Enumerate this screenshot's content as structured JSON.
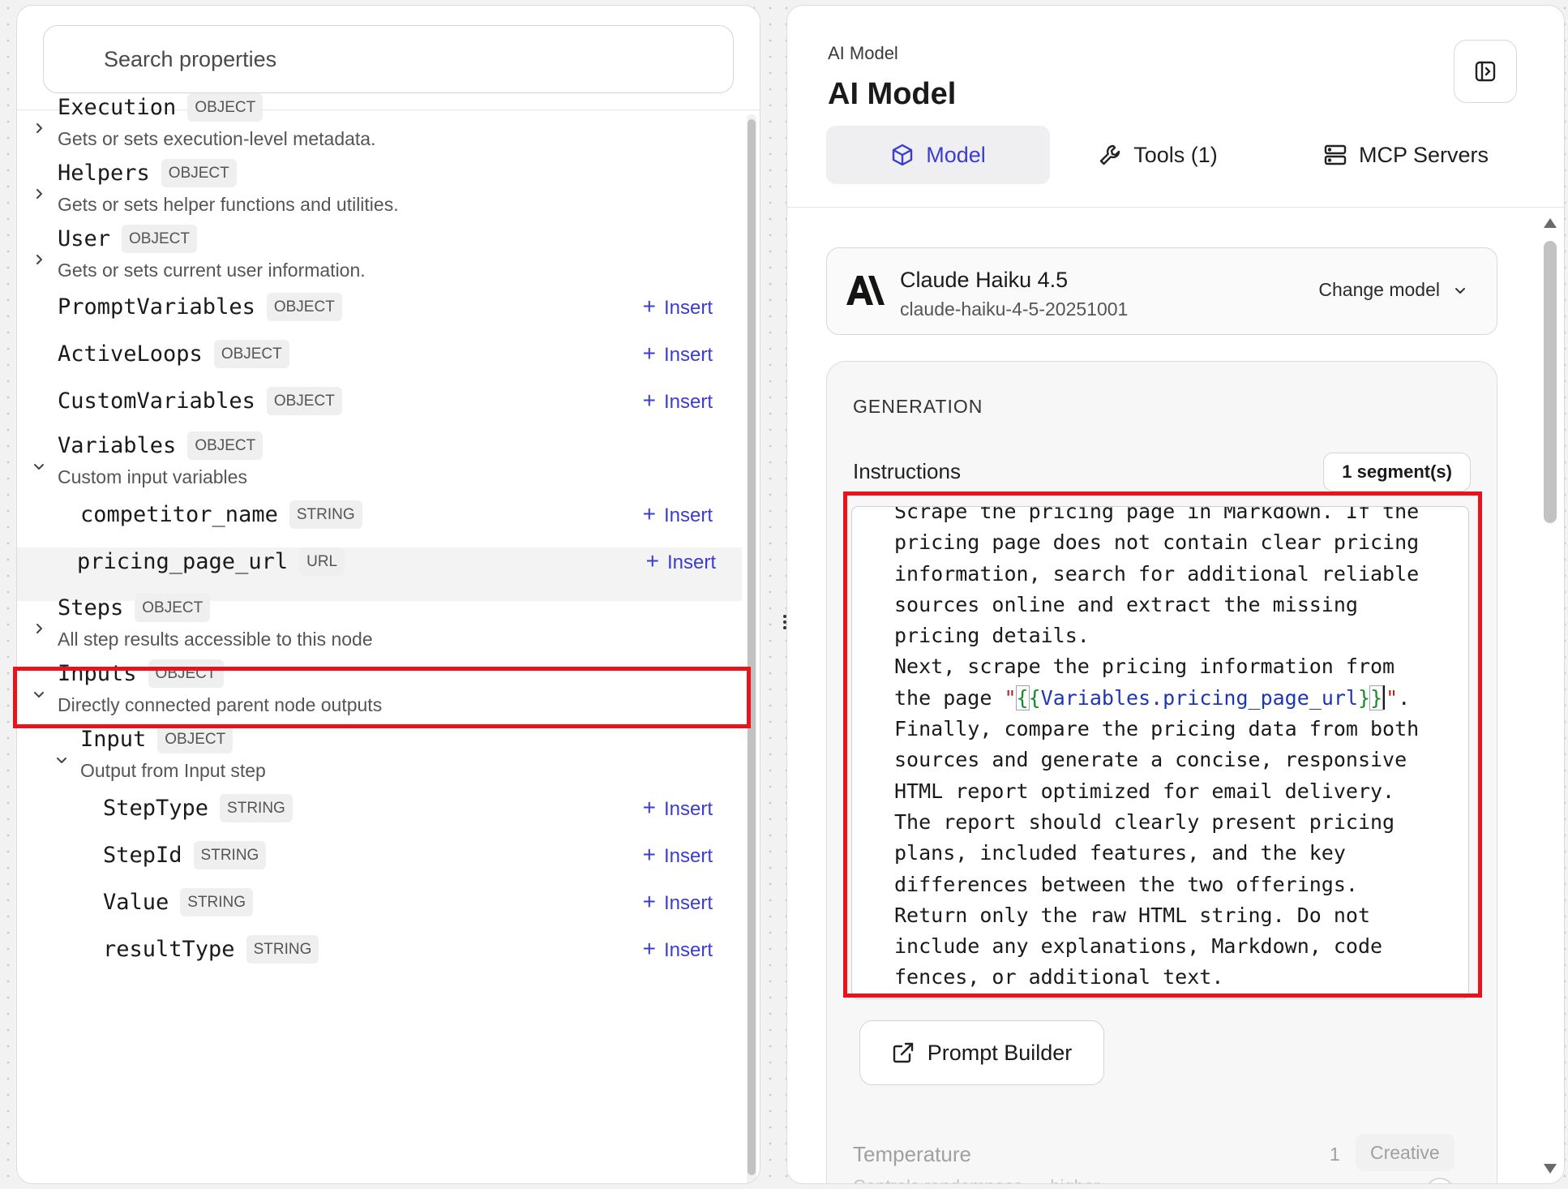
{
  "left_panel": {
    "search": {
      "placeholder": "Search properties",
      "value": ""
    },
    "properties": [
      {
        "name": "Execution",
        "type": "OBJECT",
        "desc": "Gets or sets execution-level metadata.",
        "expander": "collapsed"
      },
      {
        "name": "Helpers",
        "type": "OBJECT",
        "desc": "Gets or sets helper functions and utilities.",
        "expander": "collapsed"
      },
      {
        "name": "User",
        "type": "OBJECT",
        "desc": "Gets or sets current user information.",
        "expander": "collapsed"
      },
      {
        "name": "PromptVariables",
        "type": "OBJECT",
        "action": "Insert"
      },
      {
        "name": "ActiveLoops",
        "type": "OBJECT",
        "action": "Insert"
      },
      {
        "name": "CustomVariables",
        "type": "OBJECT",
        "action": "Insert"
      },
      {
        "name": "Variables",
        "type": "OBJECT",
        "desc": "Custom input variables",
        "expander": "expanded"
      },
      {
        "name": "competitor_name",
        "type": "STRING",
        "action": "Insert"
      },
      {
        "name": "pricing_page_url",
        "type": "URL",
        "action": "Insert",
        "selected": true
      },
      {
        "name": "Steps",
        "type": "OBJECT",
        "desc": "All step results accessible to this node",
        "expander": "collapsed"
      },
      {
        "name": "Inputs",
        "type": "OBJECT",
        "desc": "Directly connected parent node outputs",
        "expander": "expanded"
      },
      {
        "name": "Input",
        "type": "OBJECT",
        "desc": "Output from Input step",
        "expander": "expanded"
      },
      {
        "name": "StepType",
        "type": "STRING",
        "action": "Insert"
      },
      {
        "name": "StepId",
        "type": "STRING",
        "action": "Insert"
      },
      {
        "name": "Value",
        "type": "STRING",
        "action": "Insert"
      },
      {
        "name": "resultType",
        "type": "STRING",
        "action": "Insert"
      }
    ]
  },
  "right_panel": {
    "breadcrumb": "AI Model",
    "title": "AI Model",
    "tabs": [
      {
        "label": "Model",
        "icon": "cube-icon",
        "active": true
      },
      {
        "label": "Tools (1)",
        "icon": "wrench-icon",
        "active": false
      },
      {
        "label": "MCP Servers",
        "icon": "server-icon",
        "active": false
      }
    ],
    "model": {
      "name": "Claude Haiku 4.5",
      "id": "claude-haiku-4-5-20251001",
      "change_label": "Change model"
    },
    "generation": {
      "heading": "GENERATION",
      "instructions_label": "Instructions",
      "segments": "1 segment(s)",
      "instructions_lines": [
        "Scrape the pricing page in Markdown. If the",
        "pricing page does not contain clear pricing",
        "information, search for additional reliable",
        "sources online and extract the missing",
        "pricing details.",
        "Next, scrape the pricing information from",
        "the page \"{{Variables.pricing_page_url}}\".",
        "Finally, compare the pricing data from both",
        "sources and generate a concise, responsive",
        "HTML report optimized for email delivery.",
        "The report should clearly present pricing",
        "plans, included features, and the key",
        "differences between the two offerings.",
        "Return only the raw HTML string. Do not",
        "include any explanations, Markdown, code",
        "fences, or additional text."
      ],
      "prompt_builder_label": "Prompt Builder",
      "temperature": {
        "label": "Temperature",
        "value": "1",
        "mode": "Creative",
        "desc": "Controls randomness — higher"
      }
    }
  },
  "colors": {
    "accent": "#3b3cd1",
    "highlight": "#e8131b"
  }
}
